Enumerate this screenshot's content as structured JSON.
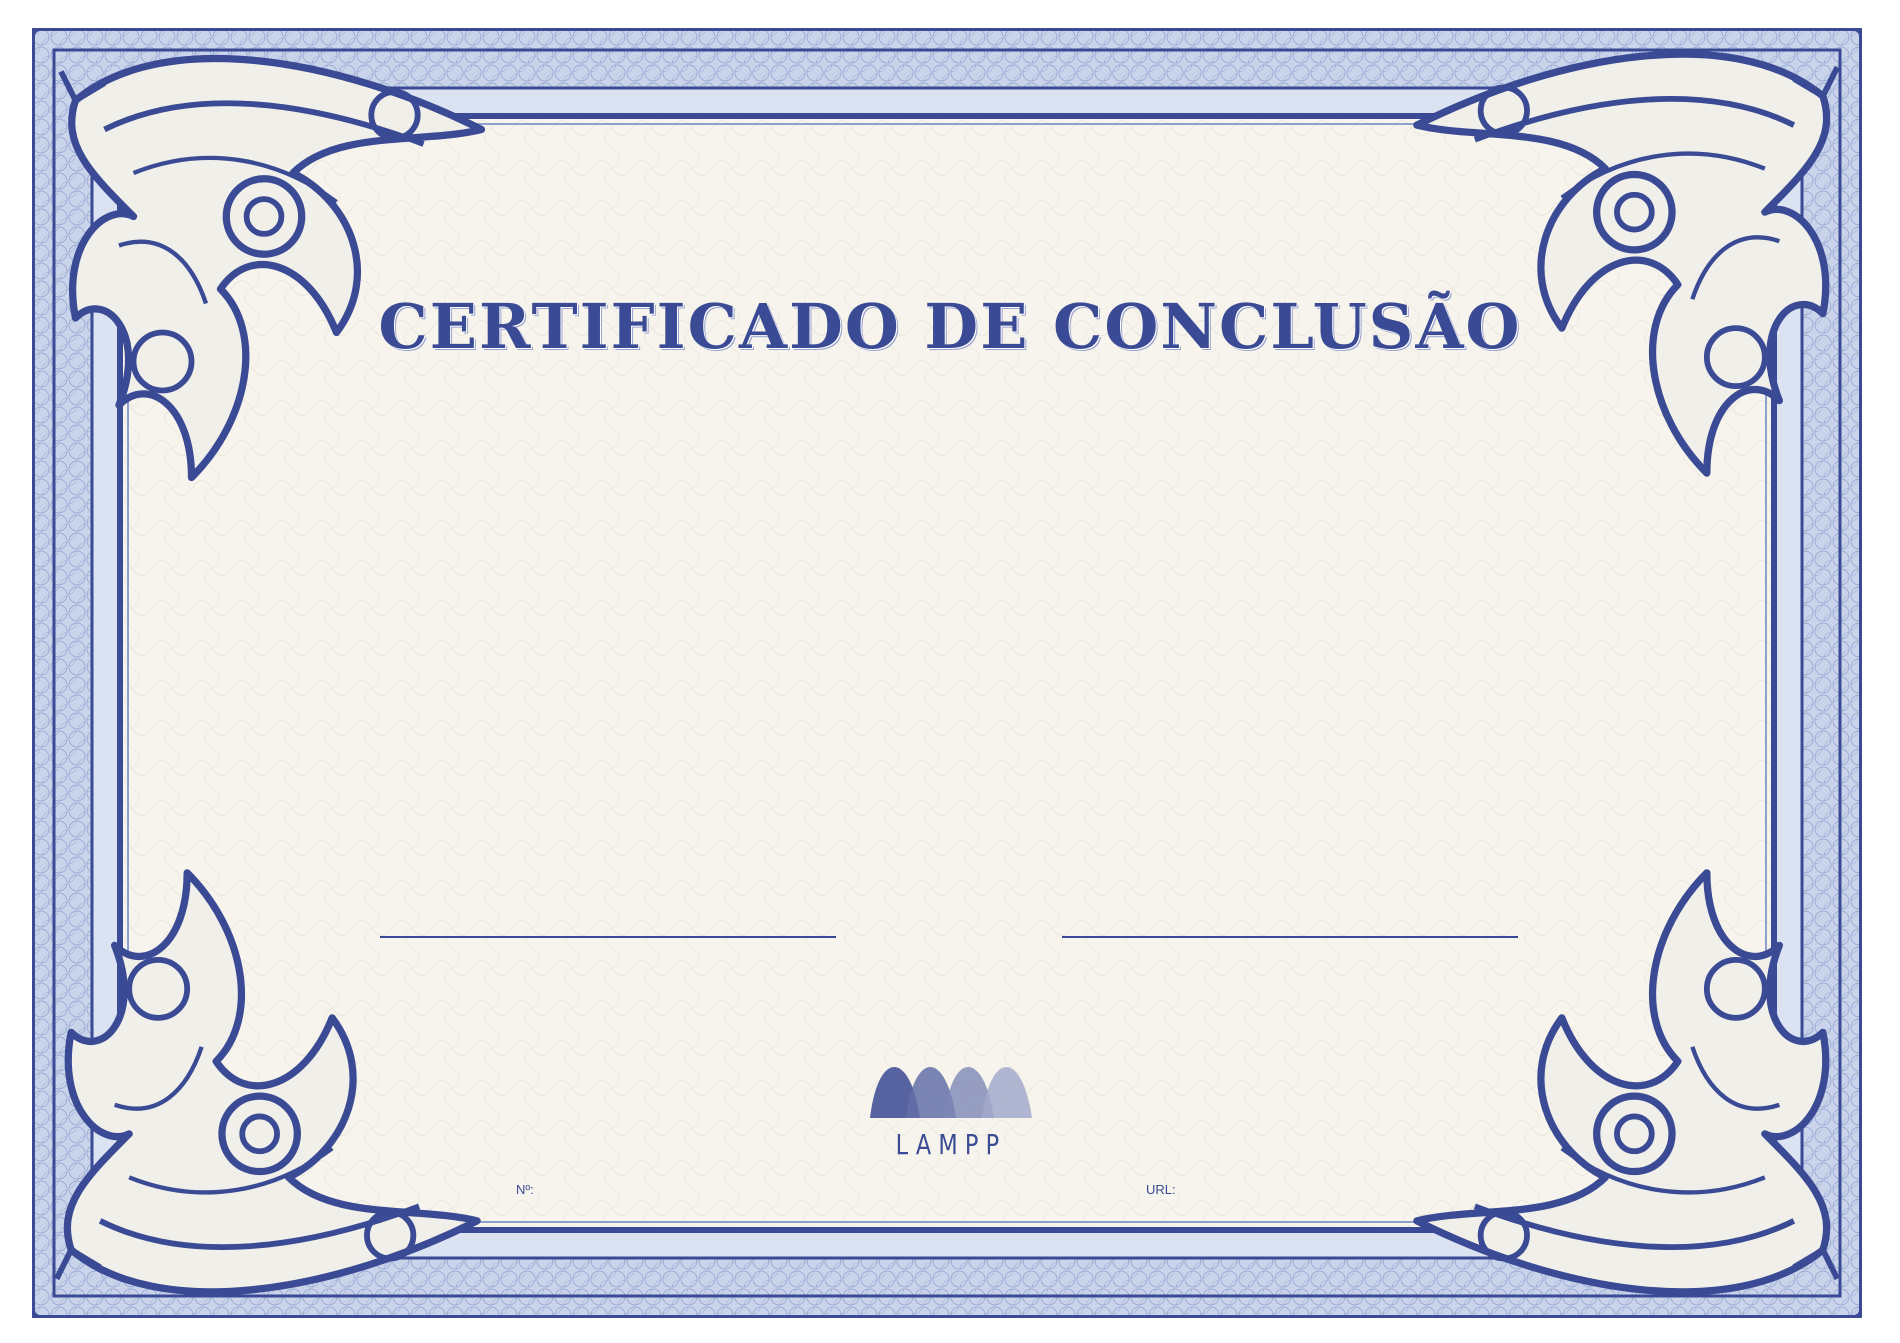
{
  "certificate": {
    "title": "CERTIFICADO DE CONCLUSÃO",
    "number_label": "Nº:",
    "url_label": "URL:",
    "logo_text": "LAMPP"
  },
  "colors": {
    "primary": "#3a4a94",
    "border_light": "#aebbdc",
    "paper": "#f6f4ec"
  }
}
